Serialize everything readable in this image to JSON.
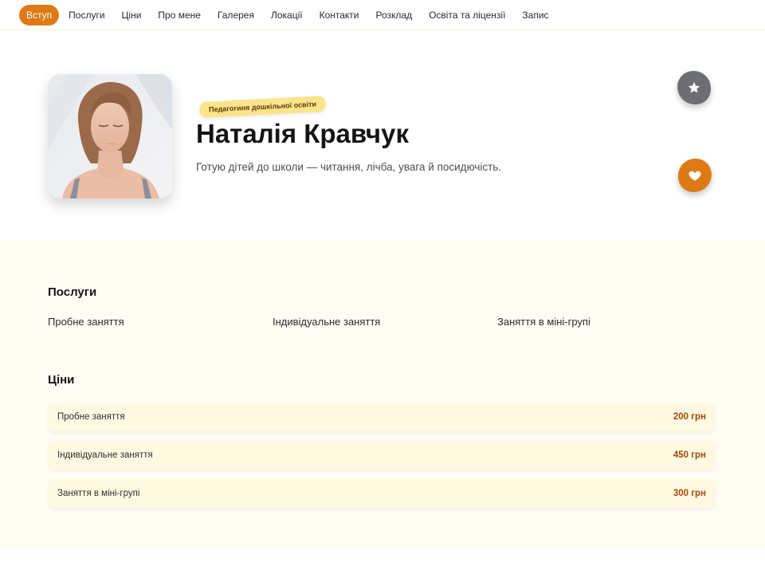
{
  "nav": {
    "items": [
      {
        "label": "Вступ",
        "active": true
      },
      {
        "label": "Послуги"
      },
      {
        "label": "Ціни"
      },
      {
        "label": "Про мене"
      },
      {
        "label": "Галерея"
      },
      {
        "label": "Локації"
      },
      {
        "label": "Контакти"
      },
      {
        "label": "Розклад"
      },
      {
        "label": "Освіта та ліцензії"
      },
      {
        "label": "Запис"
      }
    ]
  },
  "hero": {
    "badge": "Педагогиня дошкільної освіти",
    "name": "Наталія Кравчук",
    "tagline": "Готую дітей до школи — читання, лічба, увага й посидючість.",
    "star_icon": "star-icon",
    "heart_icon": "heart-icon"
  },
  "services": {
    "title": "Послуги",
    "items": [
      "Пробне заняття",
      "Індивідуальне заняття",
      "Заняття в міні-групі"
    ]
  },
  "prices": {
    "title": "Ціни",
    "rows": [
      {
        "label": "Пробне заняття",
        "value": "200 грн"
      },
      {
        "label": "Індивідуальне заняття",
        "value": "450 грн"
      },
      {
        "label": "Заняття в міні-групі",
        "value": "300 грн"
      }
    ]
  },
  "colors": {
    "accent": "#de7a16",
    "badge": "#fbe48a",
    "price": "#a14a06",
    "section_bg": "#fffcf3"
  }
}
